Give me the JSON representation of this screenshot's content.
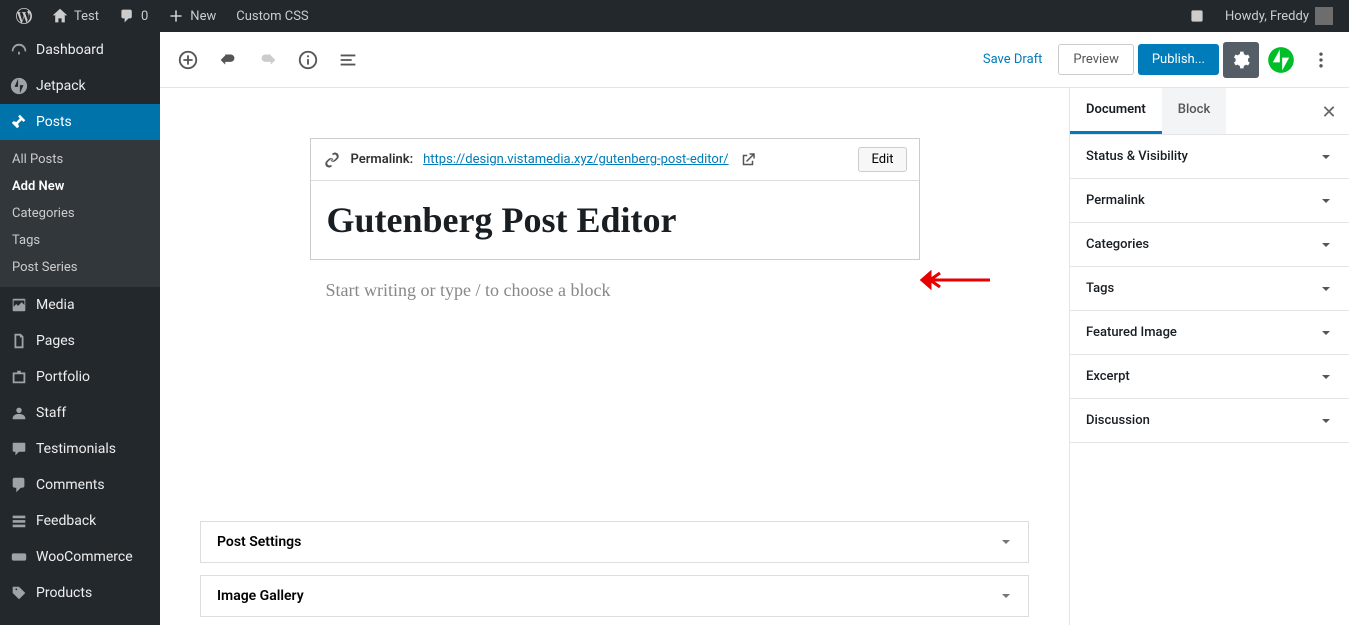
{
  "adminbar": {
    "site": "Test",
    "comments": "0",
    "new": "New",
    "customcss": "Custom CSS",
    "howdy": "Howdy, Freddy"
  },
  "sidebar": {
    "items": [
      {
        "label": "Dashboard"
      },
      {
        "label": "Jetpack"
      },
      {
        "label": "Posts"
      },
      {
        "label": "Media"
      },
      {
        "label": "Pages"
      },
      {
        "label": "Portfolio"
      },
      {
        "label": "Staff"
      },
      {
        "label": "Testimonials"
      },
      {
        "label": "Comments"
      },
      {
        "label": "Feedback"
      },
      {
        "label": "WooCommerce"
      },
      {
        "label": "Products"
      }
    ],
    "sub": [
      {
        "label": "All Posts"
      },
      {
        "label": "Add New"
      },
      {
        "label": "Categories"
      },
      {
        "label": "Tags"
      },
      {
        "label": "Post Series"
      }
    ]
  },
  "toolbar": {
    "save_draft": "Save Draft",
    "preview": "Preview",
    "publish": "Publish..."
  },
  "permalink": {
    "label": "Permalink:",
    "url": "https://design.vistamedia.xyz/gutenberg-post-editor/",
    "edit": "Edit"
  },
  "editor": {
    "title": "Gutenberg Post Editor",
    "placeholder": "Start writing or type / to choose a block"
  },
  "metaboxes": [
    {
      "label": "Post Settings"
    },
    {
      "label": "Image Gallery"
    }
  ],
  "panel": {
    "tabs": [
      {
        "label": "Document"
      },
      {
        "label": "Block"
      }
    ],
    "sections": [
      {
        "label": "Status & Visibility"
      },
      {
        "label": "Permalink"
      },
      {
        "label": "Categories"
      },
      {
        "label": "Tags"
      },
      {
        "label": "Featured Image"
      },
      {
        "label": "Excerpt"
      },
      {
        "label": "Discussion"
      }
    ]
  }
}
